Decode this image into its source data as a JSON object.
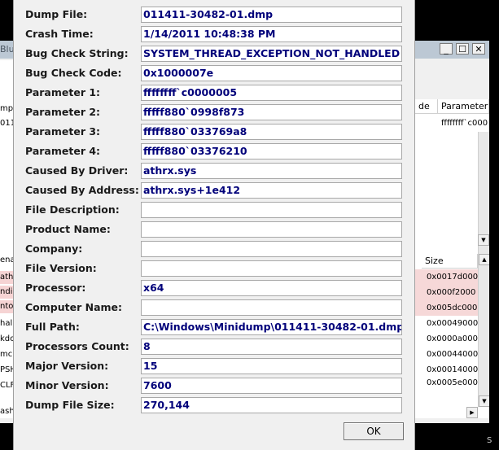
{
  "background_window": {
    "title_fragment": "Blu",
    "left_col_header": "mp",
    "left_col_row": "011",
    "right_header_col1": "de",
    "right_header_col2": "Parameter",
    "right_top_value": "ffffffff`c000",
    "left_lower_header": "ena",
    "left_lower_items": [
      "ath",
      "ndi",
      "nto",
      "hal",
      "kdc",
      "mc",
      "PSH",
      "CLF"
    ],
    "left_bottom_text": "ash",
    "size_header": "Size",
    "size_values": [
      "0x0017d000",
      "0x000f2000",
      "0x005dc000",
      "0x00049000",
      "0x0000a000",
      "0x00044000",
      "0x00014000",
      "0x0005e000"
    ],
    "bottom_right_text": "S"
  },
  "dialog": {
    "fields": [
      {
        "label": "Dump File:",
        "value": "011411-30482-01.dmp"
      },
      {
        "label": "Crash Time:",
        "value": "1/14/2011 10:48:38 PM"
      },
      {
        "label": "Bug Check String:",
        "value": "SYSTEM_THREAD_EXCEPTION_NOT_HANDLED"
      },
      {
        "label": "Bug Check Code:",
        "value": "0x1000007e"
      },
      {
        "label": "Parameter 1:",
        "value": "ffffffff`c0000005"
      },
      {
        "label": "Parameter 2:",
        "value": "fffff880`0998f873"
      },
      {
        "label": "Parameter 3:",
        "value": "fffff880`033769a8"
      },
      {
        "label": "Parameter 4:",
        "value": "fffff880`03376210"
      },
      {
        "label": "Caused By Driver:",
        "value": "athrx.sys"
      },
      {
        "label": "Caused By Address:",
        "value": "athrx.sys+1e412"
      },
      {
        "label": "File Description:",
        "value": ""
      },
      {
        "label": "Product Name:",
        "value": ""
      },
      {
        "label": "Company:",
        "value": ""
      },
      {
        "label": "File Version:",
        "value": ""
      },
      {
        "label": "Processor:",
        "value": "x64"
      },
      {
        "label": "Computer Name:",
        "value": ""
      },
      {
        "label": "Full Path:",
        "value": "C:\\Windows\\Minidump\\011411-30482-01.dmp"
      },
      {
        "label": "Processors Count:",
        "value": "8"
      },
      {
        "label": "Major Version:",
        "value": "15"
      },
      {
        "label": "Minor Version:",
        "value": "7600"
      },
      {
        "label": "Dump File Size:",
        "value": "270,144"
      }
    ],
    "ok_label": "OK"
  }
}
